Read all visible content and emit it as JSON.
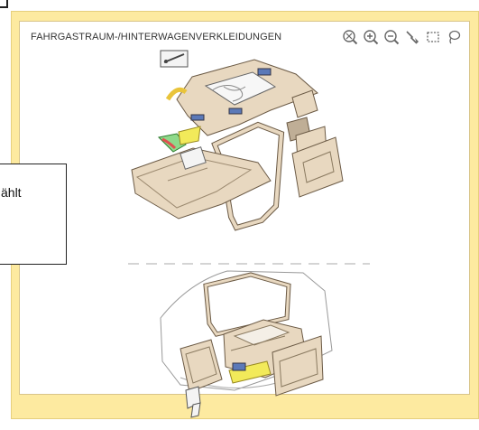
{
  "panel": {
    "title": "FAHRGASTRAUM-/HINTERWAGENVERKLEIDUNGEN"
  },
  "tooltip": {
    "text": "ählt"
  },
  "toolbar": {
    "tools": [
      {
        "name": "reset-zoom-icon"
      },
      {
        "name": "zoom-in-icon"
      },
      {
        "name": "zoom-out-icon"
      },
      {
        "name": "pointer-icon"
      },
      {
        "name": "select-rectangle-icon"
      },
      {
        "name": "lasso-icon"
      }
    ]
  },
  "colors": {
    "frame": "#fdeaa0",
    "part_fill": "#e8d8c0",
    "highlight_yellow": "#f2ea5a",
    "highlight_green": "#8fd98a",
    "highlight_red": "#e05050",
    "highlight_blue": "#5b79b8"
  }
}
